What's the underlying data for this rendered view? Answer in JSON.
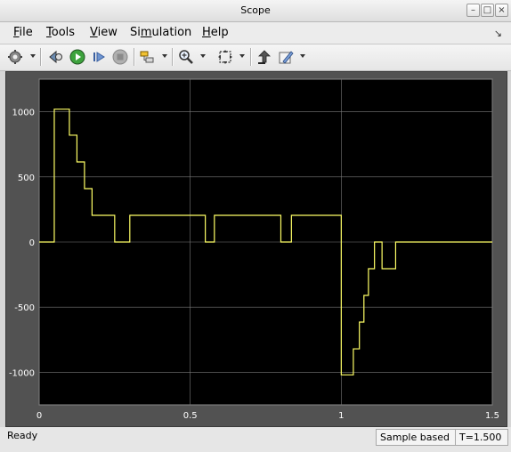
{
  "window": {
    "title": "Scope"
  },
  "menu": [
    {
      "accel": "F",
      "rest": "ile"
    },
    {
      "accel": "T",
      "rest": "ools"
    },
    {
      "accel": "V",
      "rest": "iew"
    },
    {
      "accel": "",
      "pre": "Si",
      "accel2": "m",
      "rest": "ulation"
    },
    {
      "accel": "H",
      "rest": "elp"
    }
  ],
  "toolbar": {
    "icons": [
      "gear-icon",
      "highlight-icon",
      "run-icon",
      "step-forward-icon",
      "stop-icon",
      "trigger-icon",
      "zoom-in-icon",
      "autoscale-icon",
      "restore-layout-icon",
      "style-icon"
    ]
  },
  "status": {
    "left": "Ready",
    "mode": "Sample based",
    "time": "T=1.500"
  },
  "colors": {
    "plot_bg": "#000000",
    "frame_bg": "#525252",
    "grid": "#7a7a7a",
    "trace": "#ffff66",
    "axis_text": "#ffffff"
  },
  "chart_data": {
    "type": "line",
    "step": true,
    "xlim": [
      0,
      1.5
    ],
    "ylim": [
      -1250,
      1250
    ],
    "x_ticks": [
      0,
      0.5,
      1,
      1.5
    ],
    "x_tick_labels": [
      "0",
      "0.5",
      "1",
      "1.5"
    ],
    "y_ticks": [
      1000,
      500,
      0,
      -500,
      -1000
    ],
    "y_tick_labels": [
      "1000",
      "500",
      "0",
      "-500",
      "-1000"
    ],
    "grid": true,
    "series": [
      {
        "x": [
          0,
          0.05,
          0.1,
          0.125,
          0.15,
          0.175,
          0.25,
          0.3,
          0.55,
          0.58,
          0.8,
          0.835,
          1.0,
          1.04,
          1.06,
          1.075,
          1.09,
          1.11,
          1.135,
          1.18,
          1.22,
          1.5
        ],
        "y": [
          0,
          1020,
          820,
          615,
          410,
          205,
          0,
          205,
          0,
          205,
          0,
          205,
          -1020,
          -820,
          -615,
          -410,
          -205,
          0,
          -205,
          0,
          0,
          0
        ]
      }
    ]
  }
}
